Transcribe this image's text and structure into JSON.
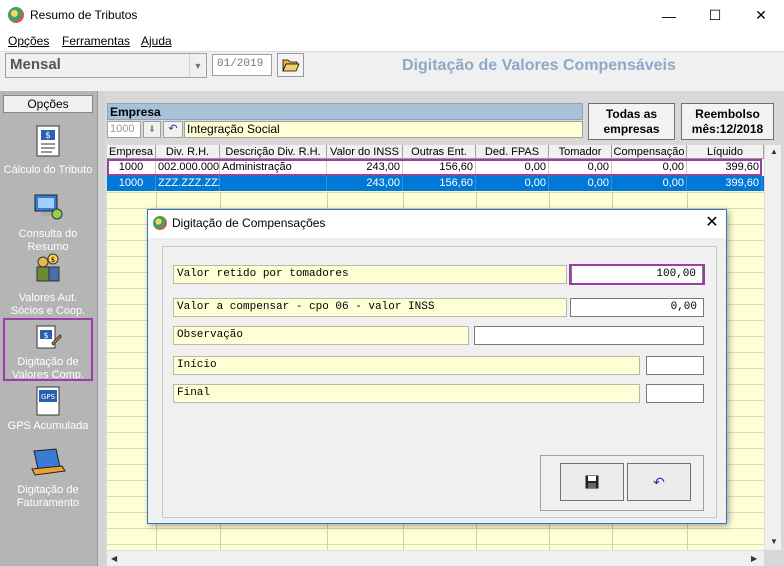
{
  "window": {
    "title": "Resumo de Tributos",
    "minimize_icon": "—",
    "maximize_icon": "☐",
    "close_icon": "✕"
  },
  "menu": {
    "items": [
      {
        "label": "Opções"
      },
      {
        "label": "Ferramentas"
      },
      {
        "label": "Ajuda"
      }
    ]
  },
  "toolbar": {
    "period": "Mensal",
    "period_arrow": "▼",
    "date": "01/2019",
    "header_title": "Digitação de Valores Compensáveis"
  },
  "sidebar": {
    "header": "Opções",
    "items": [
      {
        "label": "Cálculo do Tributo",
        "icon": "calculator-document-icon"
      },
      {
        "label": "Consulta do Resumo",
        "icon": "computer-icon"
      },
      {
        "label": "Valores Aut. Sócios e Coop.",
        "icon": "people-money-icon"
      },
      {
        "label": "Digitação de Valores Comp.",
        "icon": "edit-money-icon"
      },
      {
        "label": "GPS Acumulada",
        "icon": "gps-document-icon"
      },
      {
        "label": "Digitação de Faturamento",
        "icon": "laptop-icon"
      }
    ]
  },
  "empresa": {
    "label": "Empresa",
    "code": "1000",
    "down_arrow": "⬇",
    "undo": "↶",
    "name": "Integração Social",
    "todas_button": "Todas as empresas",
    "reembolso_button": "Reembolso mês:12/2018"
  },
  "table": {
    "columns": [
      "Empresa",
      "Div. R.H.",
      "Descrição Div. R.H.",
      "Valor do INSS",
      "Outras Ent.",
      "Ded. FPAS",
      "Tomador",
      "Compensação",
      "Líquido"
    ],
    "rows": [
      [
        "1000",
        "002.000.000",
        "Administração",
        "243,00",
        "156,60",
        "0,00",
        "0,00",
        "0,00",
        "399,60"
      ],
      [
        "1000",
        "ZZZ.ZZZ.ZZZ",
        "",
        "243,00",
        "156,60",
        "0,00",
        "0,00",
        "0,00",
        "399,60"
      ]
    ]
  },
  "dialog": {
    "title": "Digitação de Compensações",
    "close_icon": "✕",
    "fields": {
      "valor_retido_label": "Valor retido por tomadores",
      "valor_retido_value": "100,00",
      "valor_compensar_label": "Valor a compensar - cpo 06 - valor INSS",
      "valor_compensar_value": "0,00",
      "observacao_label": "Observação",
      "observacao_value": "",
      "inicio_label": "Início",
      "inicio_value": "",
      "final_label": "Final",
      "final_value": ""
    },
    "save_icon": "floppy-disk-icon",
    "undo_icon": "undo-icon",
    "undo_glyph": "↶"
  },
  "colors": {
    "accent_highlight": "#9b3fa6",
    "selection": "#0078d7",
    "header_title": "#8ca9c8",
    "field_yellow": "#ffffd6"
  }
}
